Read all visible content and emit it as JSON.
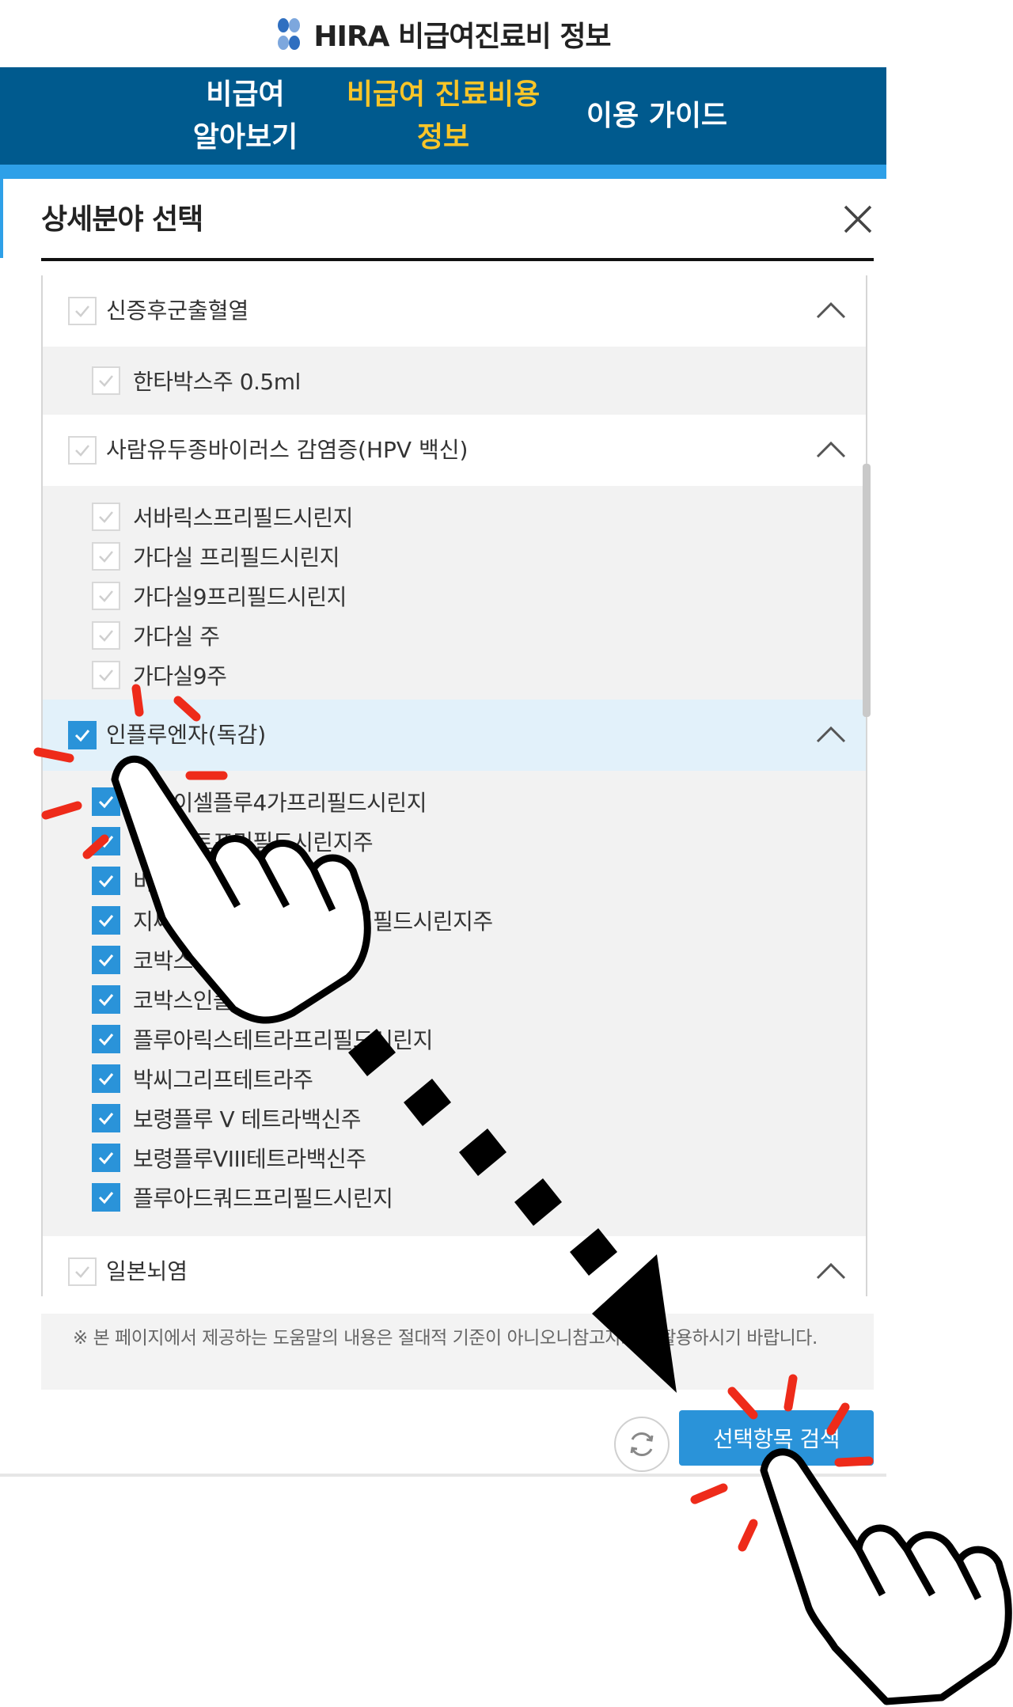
{
  "header": {
    "title": "HIRA 비급여진료비 정보"
  },
  "nav": {
    "items": [
      {
        "label": "비급여\n알아보기",
        "active": false
      },
      {
        "label": "비급여 진료비용\n정보",
        "active": true
      },
      {
        "label": "이용 가이드",
        "active": false
      }
    ]
  },
  "panel": {
    "title": "상세분야 선택",
    "groups": [
      {
        "label": "신증후군출혈열",
        "checked": false,
        "expanded": true,
        "items": [
          {
            "label": "한타박스주 0.5ml",
            "checked": false
          }
        ]
      },
      {
        "label": "사람유두종바이러스 감염증(HPV 백신)",
        "checked": false,
        "expanded": true,
        "items": [
          {
            "label": "서바릭스프리필드시린지",
            "checked": false
          },
          {
            "label": "가다실 프리필드시린지",
            "checked": false
          },
          {
            "label": "가다실9프리필드시린지",
            "checked": false
          },
          {
            "label": "가다실 주",
            "checked": false
          },
          {
            "label": "가다실9주",
            "checked": false
          }
        ]
      },
      {
        "label": "인플루엔자(독감)",
        "checked": true,
        "expanded": true,
        "active": true,
        "items": [
          {
            "label": "스카이셀플루4가프리필드시린지",
            "checked": true
          },
          {
            "label": "테라텍트프리필드시린지주",
            "checked": true
          },
          {
            "label": "비알플루텍트라주",
            "checked": true
          },
          {
            "label": "지씨플루쿼드리밸런트프리필드시린지주",
            "checked": true
          },
          {
            "label": "코박스플루4가주",
            "checked": true
          },
          {
            "label": "코박스인플루4가주",
            "checked": true
          },
          {
            "label": "플루아릭스테트라프리필드시린지",
            "checked": true
          },
          {
            "label": "박씨그리프테트라주",
            "checked": true
          },
          {
            "label": "보령플루 V 테트라백신주",
            "checked": true
          },
          {
            "label": "보령플루VIII테트라백신주",
            "checked": true
          },
          {
            "label": "플루아드쿼드프리필드시린지",
            "checked": true
          }
        ]
      },
      {
        "label": "일본뇌염",
        "checked": false,
        "expanded": true,
        "items": []
      }
    ],
    "notice": "※ 본 페이지에서 제공하는 도움말의 내용은 절대적 기준이 아니오니참고자료로 활용하시기 바랍니다.",
    "search_button": "선택항목 검색"
  },
  "colors": {
    "nav_bg": "#005a8e",
    "nav_active": "#f9c528",
    "accent": "#2a93d9",
    "annotation_burst": "#ee2b1a"
  },
  "icons": {
    "logo": "hira-logo-icon",
    "close": "close-icon",
    "chevron": "chevron-up-icon",
    "reset": "refresh-icon",
    "pointer": "pointing-hand-icon",
    "arrow": "dashed-arrow-icon"
  }
}
